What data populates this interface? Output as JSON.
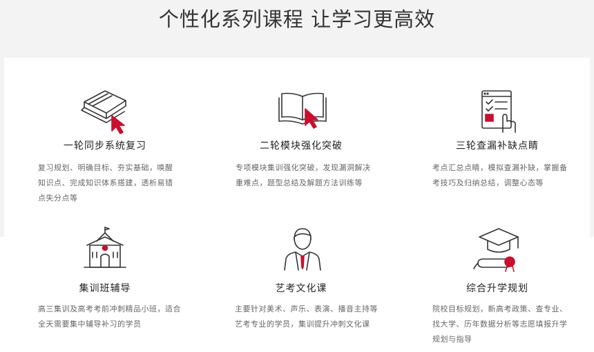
{
  "page": {
    "title": "个性化系列课程 让学习更高效"
  },
  "colors": {
    "accent": "#c8102e",
    "header_bg": "#f3f3f3",
    "icon_stroke": "#333333"
  },
  "cards": [
    {
      "icon": "book-icon",
      "title": "一轮同步系统复习",
      "desc": "复习规划、明确目标、夯实基础，唤醒知识点、完成知识体系搭建，透析易错点失分点等"
    },
    {
      "icon": "open-book-icon",
      "title": "二轮模块强化突破",
      "desc": "专项模块集训强化突破，发现漏洞解决重难点，题型总结及解题方法训练等"
    },
    {
      "icon": "checklist-icon",
      "title": "三轮查漏补缺点睛",
      "desc": "考点汇总点睛，模拟查漏补缺，掌握备考技巧及归纳总结，调整心态等"
    },
    {
      "icon": "school-icon",
      "title": "集训班辅导",
      "desc": "高三集训及高考考前冲刺精品小班，适合全天需要集中辅导补习的学员"
    },
    {
      "icon": "student-icon",
      "title": "艺考文化课",
      "desc": "主要针对美术、声乐、表演、播音主持等艺考专业的学员，集训提升冲刺文化课"
    },
    {
      "icon": "graduation-icon",
      "title": "综合升学规划",
      "desc": "院校目标规划，新高考政策、查专业、找大学、历年数据分析等志愿填报升学规划与指导"
    }
  ]
}
